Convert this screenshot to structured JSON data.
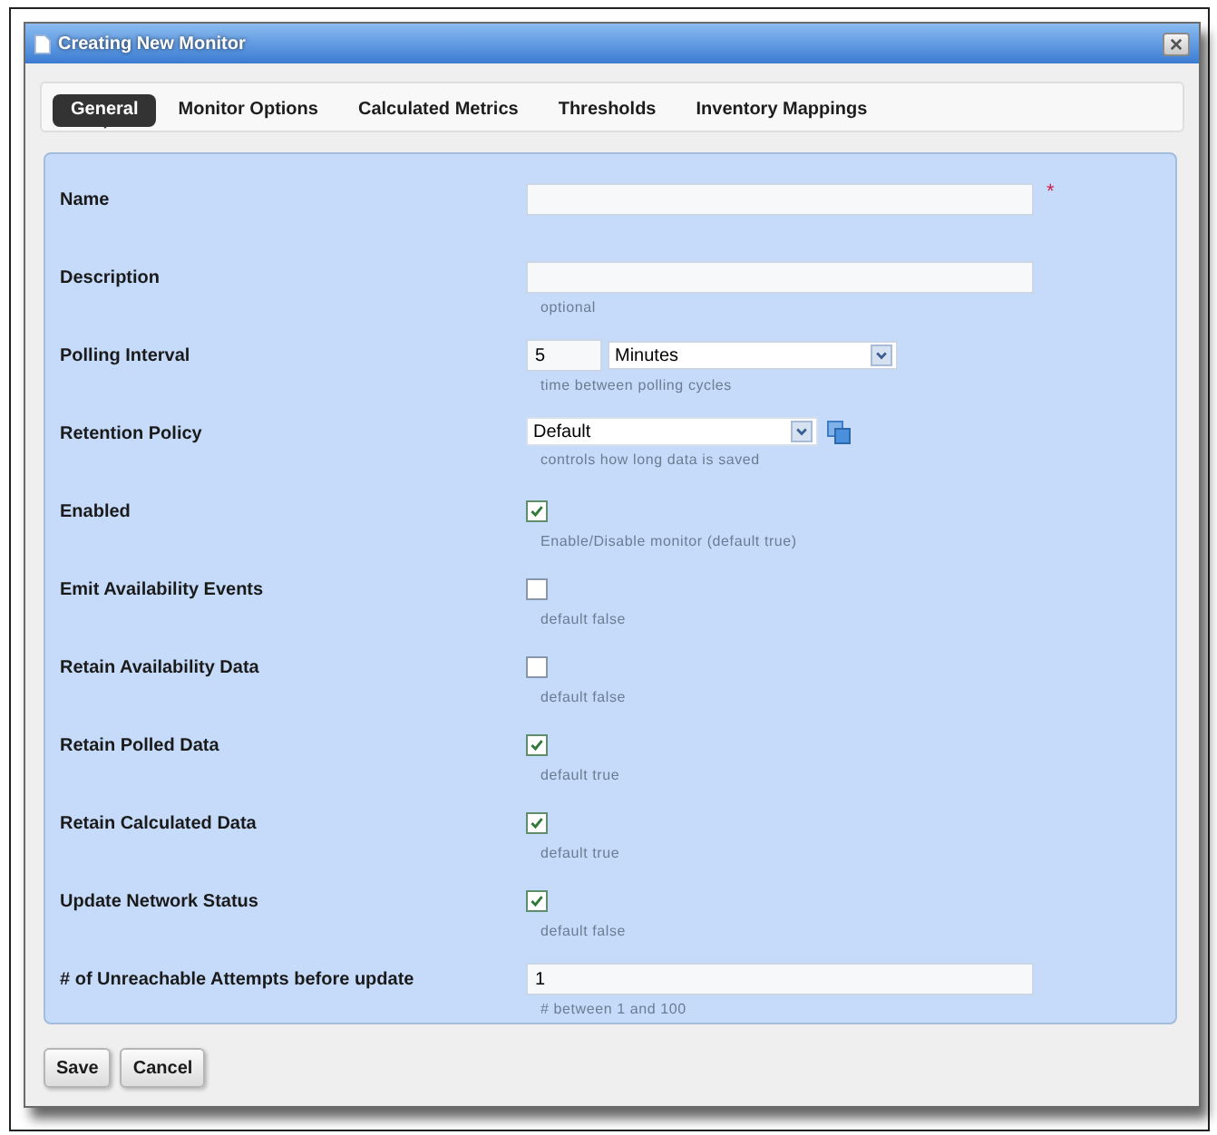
{
  "window": {
    "title": "Creating New Monitor"
  },
  "tabs": [
    {
      "label": "General",
      "selected": true
    },
    {
      "label": "Monitor Options",
      "selected": false
    },
    {
      "label": "Calculated Metrics",
      "selected": false
    },
    {
      "label": "Thresholds",
      "selected": false
    },
    {
      "label": "Inventory Mappings",
      "selected": false
    }
  ],
  "form": {
    "fields": [
      {
        "kind": "text",
        "label": "Name",
        "required_mark": "*"
      },
      {
        "kind": "text",
        "label": "Description",
        "hint": "optional"
      },
      {
        "kind": "interval",
        "label": "Polling Interval",
        "value": "5",
        "unit": "Minutes",
        "hint": "time between polling cycles"
      },
      {
        "kind": "select",
        "label": "Retention Policy",
        "value": "Default",
        "hint": "controls how long data is saved"
      },
      {
        "kind": "checkbox",
        "label": "Enabled",
        "checked": true,
        "hint": "Enable/Disable monitor (default true)"
      },
      {
        "kind": "checkbox",
        "label": "Emit Availability Events",
        "checked": false,
        "hint": "default false"
      },
      {
        "kind": "checkbox",
        "label": "Retain Availability Data",
        "checked": false,
        "hint": "default false"
      },
      {
        "kind": "checkbox",
        "label": "Retain Polled Data",
        "checked": true,
        "hint": "default true"
      },
      {
        "kind": "checkbox",
        "label": "Retain Calculated Data",
        "checked": true,
        "hint": "default true"
      },
      {
        "kind": "checkbox",
        "label": "Update Network Status",
        "checked": true,
        "hint": "default false"
      },
      {
        "kind": "text",
        "label": "# of Unreachable Attempts before update",
        "value": "1",
        "hint": "# between 1 and 100"
      }
    ]
  },
  "buttons": [
    {
      "label": "Save"
    },
    {
      "label": "Cancel"
    }
  ]
}
